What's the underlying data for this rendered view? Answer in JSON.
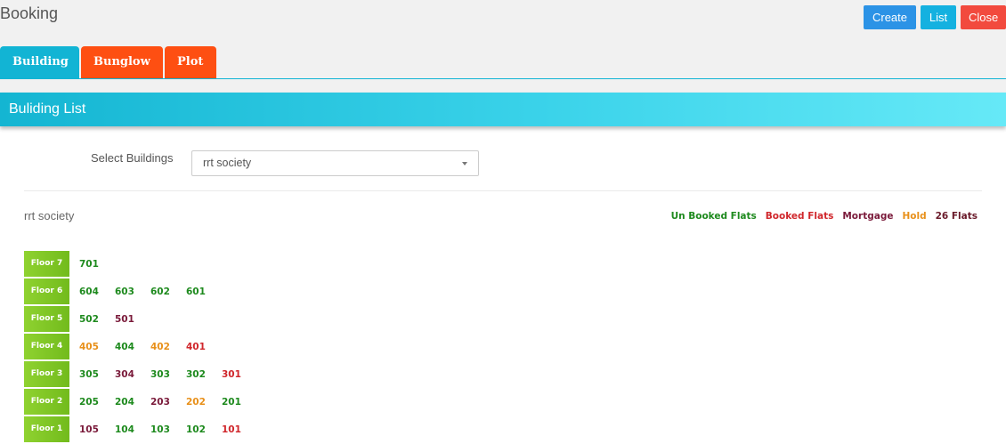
{
  "page": {
    "title": "Booking"
  },
  "top_buttons": {
    "create": "Create",
    "list": "List",
    "close": "Close"
  },
  "tabs": [
    {
      "label": "Building"
    },
    {
      "label": "Bunglow"
    },
    {
      "label": "Plot"
    }
  ],
  "panel": {
    "title": "Buliding List",
    "select_label": "Select Buildings",
    "select_value": "rrt society",
    "society_name": "rrt society"
  },
  "colors": {
    "unbooked": "#1e8a1e",
    "booked": "#d0262b",
    "mortgage": "#7a1a3a",
    "hold": "#e8901a",
    "count": "#6a1a2a"
  },
  "legend": [
    {
      "label": "Un Booked Flats",
      "status": "unbooked"
    },
    {
      "label": "Booked Flats",
      "status": "booked"
    },
    {
      "label": "Mortgage",
      "status": "mortgage"
    },
    {
      "label": "Hold",
      "status": "hold"
    },
    {
      "label": "26 Flats",
      "status": "count"
    }
  ],
  "floors": [
    {
      "label": "Floor 7",
      "flats": [
        {
          "no": "701",
          "status": "unbooked"
        }
      ]
    },
    {
      "label": "Floor 6",
      "flats": [
        {
          "no": "604",
          "status": "unbooked"
        },
        {
          "no": "603",
          "status": "unbooked"
        },
        {
          "no": "602",
          "status": "unbooked"
        },
        {
          "no": "601",
          "status": "unbooked"
        }
      ]
    },
    {
      "label": "Floor 5",
      "flats": [
        {
          "no": "502",
          "status": "unbooked"
        },
        {
          "no": "501",
          "status": "mortgage"
        }
      ]
    },
    {
      "label": "Floor 4",
      "flats": [
        {
          "no": "405",
          "status": "hold"
        },
        {
          "no": "404",
          "status": "unbooked"
        },
        {
          "no": "402",
          "status": "hold"
        },
        {
          "no": "401",
          "status": "booked"
        }
      ]
    },
    {
      "label": "Floor 3",
      "flats": [
        {
          "no": "305",
          "status": "unbooked"
        },
        {
          "no": "304",
          "status": "mortgage"
        },
        {
          "no": "303",
          "status": "unbooked"
        },
        {
          "no": "302",
          "status": "unbooked"
        },
        {
          "no": "301",
          "status": "booked"
        }
      ]
    },
    {
      "label": "Floor 2",
      "flats": [
        {
          "no": "205",
          "status": "unbooked"
        },
        {
          "no": "204",
          "status": "unbooked"
        },
        {
          "no": "203",
          "status": "mortgage"
        },
        {
          "no": "202",
          "status": "hold"
        },
        {
          "no": "201",
          "status": "unbooked"
        }
      ]
    },
    {
      "label": "Floor 1",
      "flats": [
        {
          "no": "105",
          "status": "mortgage"
        },
        {
          "no": "104",
          "status": "unbooked"
        },
        {
          "no": "103",
          "status": "unbooked"
        },
        {
          "no": "102",
          "status": "unbooked"
        },
        {
          "no": "101",
          "status": "booked"
        }
      ]
    }
  ]
}
